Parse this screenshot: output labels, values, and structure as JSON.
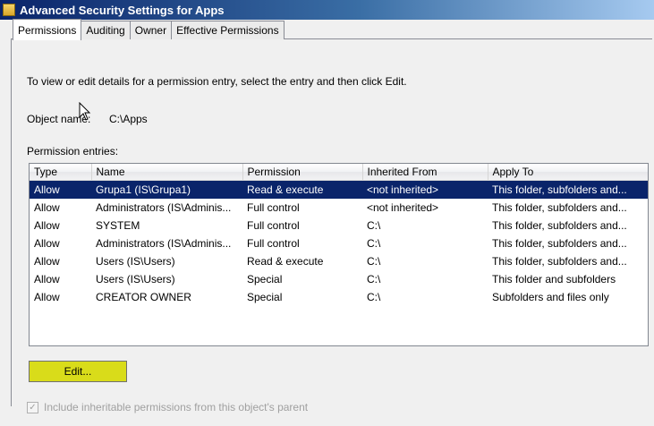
{
  "window": {
    "title": "Advanced Security Settings for Apps"
  },
  "tabs": [
    {
      "label": "Permissions",
      "active": true
    },
    {
      "label": "Auditing",
      "active": false
    },
    {
      "label": "Owner",
      "active": false
    },
    {
      "label": "Effective Permissions",
      "active": false
    }
  ],
  "instructions": "To view or edit details for a permission entry, select the entry and then click Edit.",
  "object": {
    "label": "Object name:",
    "value": "C:\\Apps"
  },
  "entries_label": "Permission entries:",
  "table": {
    "columns": [
      "Type",
      "Name",
      "Permission",
      "Inherited From",
      "Apply To"
    ],
    "rows": [
      [
        "Allow",
        "Grupa1 (IS\\Grupa1)",
        "Read & execute",
        "<not inherited>",
        "This folder, subfolders and..."
      ],
      [
        "Allow",
        "Administrators (IS\\Adminis...",
        "Full control",
        "<not inherited>",
        "This folder, subfolders and..."
      ],
      [
        "Allow",
        "SYSTEM",
        "Full control",
        "C:\\",
        "This folder, subfolders and..."
      ],
      [
        "Allow",
        "Administrators (IS\\Adminis...",
        "Full control",
        "C:\\",
        "This folder, subfolders and..."
      ],
      [
        "Allow",
        "Users (IS\\Users)",
        "Read & execute",
        "C:\\",
        "This folder, subfolders and..."
      ],
      [
        "Allow",
        "Users (IS\\Users)",
        "Special",
        "C:\\",
        "This folder and subfolders"
      ],
      [
        "Allow",
        "CREATOR OWNER",
        "Special",
        "C:\\",
        "Subfolders and files only"
      ]
    ],
    "selected_row": 0
  },
  "edit_button": {
    "label": "Edit..."
  },
  "inherit_checkbox": {
    "label": "Include inheritable permissions from this object's parent",
    "checked": true,
    "enabled": false
  },
  "icons": {
    "title": "folder-icon",
    "pointer": "mouse-pointer-icon"
  },
  "colors": {
    "selection": "#0a246a",
    "edit_highlight": "#d9dc1a"
  }
}
